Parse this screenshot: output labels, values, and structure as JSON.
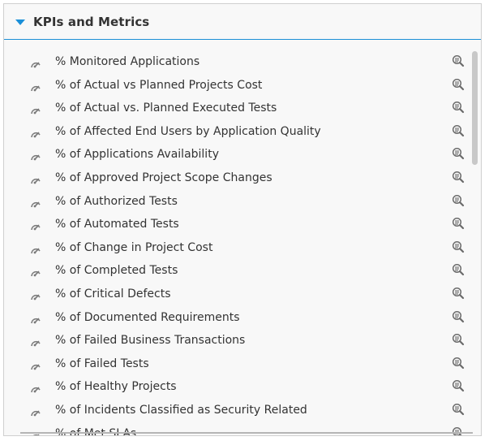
{
  "panel": {
    "title": "KPIs and Metrics",
    "accent_color": "#1a8fd8"
  },
  "kpis": [
    {
      "label": "% Monitored Applications"
    },
    {
      "label": "% of Actual vs Planned Projects Cost"
    },
    {
      "label": "% of Actual vs. Planned Executed Tests"
    },
    {
      "label": "% of Affected End Users by Application Quality"
    },
    {
      "label": "% of Applications Availability"
    },
    {
      "label": "% of Approved Project Scope Changes"
    },
    {
      "label": "% of Authorized Tests"
    },
    {
      "label": "% of Automated Tests"
    },
    {
      "label": "% of Change in Project Cost"
    },
    {
      "label": "% of Completed Tests"
    },
    {
      "label": "% of Critical Defects"
    },
    {
      "label": "% of Documented Requirements"
    },
    {
      "label": "% of Failed Business Transactions"
    },
    {
      "label": "% of Failed Tests"
    },
    {
      "label": "% of Healthy Projects"
    },
    {
      "label": "% of Incidents Classified as Security Related"
    },
    {
      "label": "% of Met SLAs"
    }
  ],
  "icons": {
    "item_icon": "gauge-icon",
    "action_icon": "magnifier-details-icon"
  }
}
